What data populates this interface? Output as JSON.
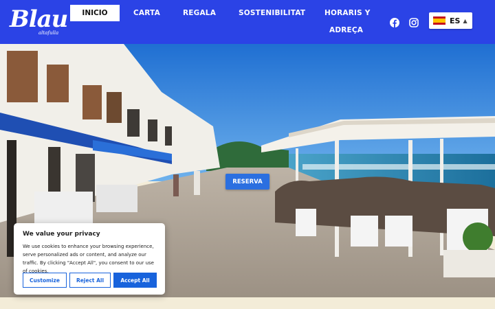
{
  "logo": {
    "main": "Blau",
    "sub": "altafulla"
  },
  "nav": {
    "active": "INICIO",
    "items": [
      "CARTA",
      "REGALA",
      "SOSTENIBILITAT"
    ],
    "horaris_line1": "HORARIS Y",
    "horaris_line2": "ADREÇA"
  },
  "social": {
    "facebook": "facebook-icon",
    "instagram": "instagram-icon"
  },
  "language": {
    "code": "ES",
    "flag": "spain-flag-icon"
  },
  "hero": {
    "reserva_label": "RESERVA"
  },
  "cookie": {
    "title": "We value your privacy",
    "text": "We use cookies to enhance your browsing experience, serve personalized ads or content, and analyze our traffic. By clicking \"Accept All\", you consent to our use of cookies.",
    "customize": "Customize",
    "reject": "Reject All",
    "accept": "Accept All"
  },
  "colors": {
    "header": "#2b43e6",
    "accent": "#1863dc",
    "below_fold": "#f3ecd8"
  }
}
